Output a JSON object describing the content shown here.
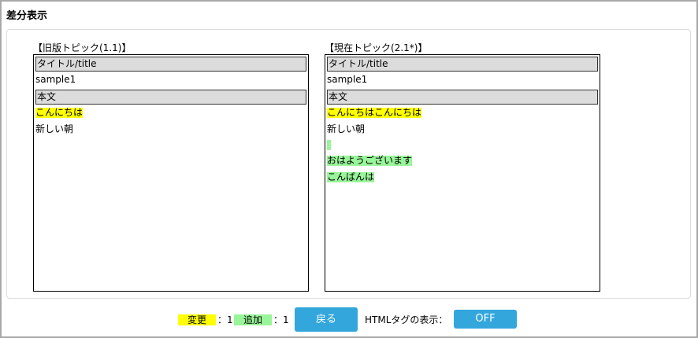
{
  "page": {
    "title": "差分表示"
  },
  "left": {
    "title": "【旧版トピック(1.1)】",
    "rows": [
      {
        "kind": "header",
        "text": "タイトル/title"
      },
      {
        "kind": "plain",
        "text": "sample1"
      },
      {
        "kind": "header",
        "text": "本文"
      },
      {
        "kind": "changed",
        "text": "こんにちは"
      },
      {
        "kind": "plain",
        "text": "新しい朝"
      }
    ]
  },
  "right": {
    "title": "【現在トピック(2.1*)】",
    "rows": [
      {
        "kind": "header",
        "text": "タイトル/title"
      },
      {
        "kind": "plain",
        "text": "sample1"
      },
      {
        "kind": "header",
        "text": "本文"
      },
      {
        "kind": "changed",
        "text": "こんにちはこんにちは"
      },
      {
        "kind": "plain",
        "text": "新しい朝"
      },
      {
        "kind": "added-empty",
        "text": ""
      },
      {
        "kind": "added",
        "text": "おはようございます"
      },
      {
        "kind": "added",
        "text": "こんばんは"
      }
    ]
  },
  "legend": {
    "changed_label": "変更",
    "changed_count": "：1",
    "added_label": "追加",
    "added_count": "：1",
    "changed_color": "#ffff00",
    "added_color": "#99f599"
  },
  "buttons": {
    "back_label": "戻る",
    "html_tag_label": "HTMLタグの表示：",
    "html_toggle_label": "OFF",
    "accent": "#33a6dc"
  }
}
